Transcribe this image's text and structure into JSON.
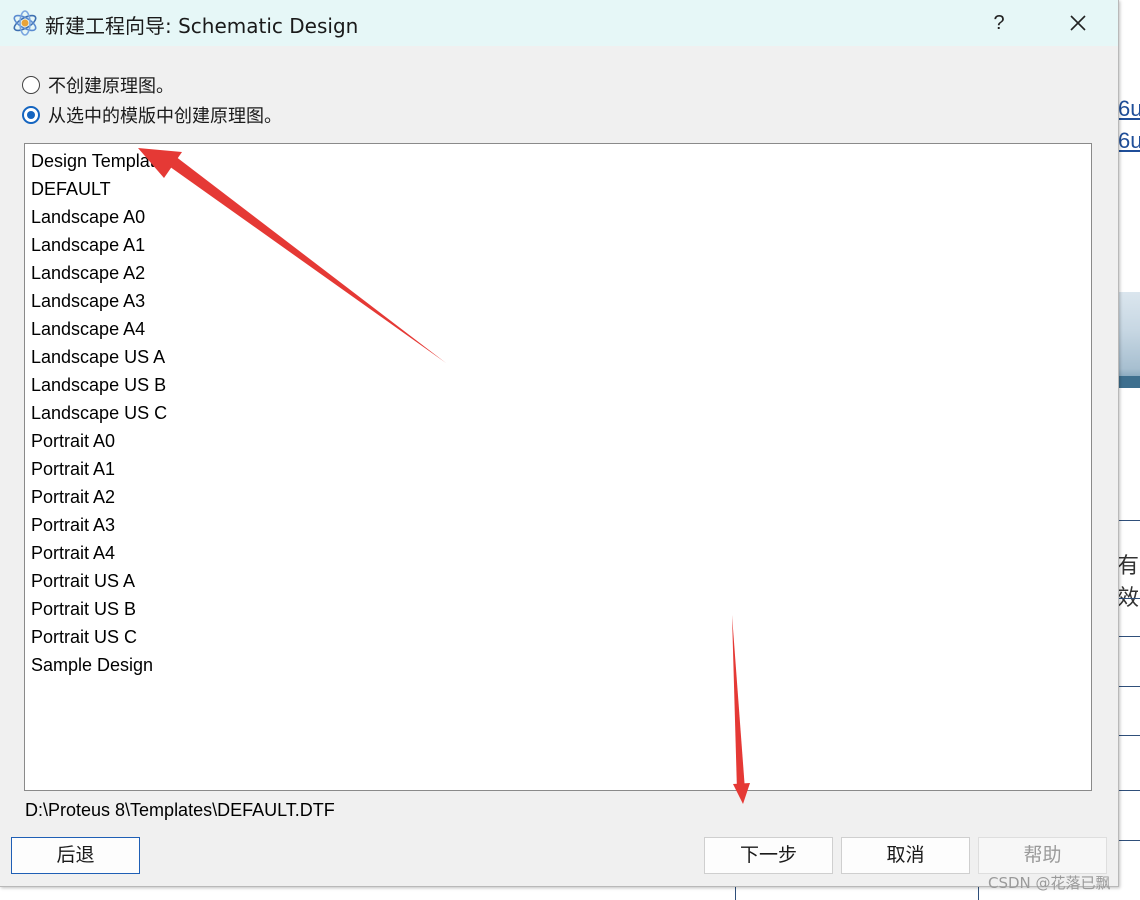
{
  "window": {
    "title": "新建工程向导: Schematic Design",
    "help_label": "?"
  },
  "options": [
    {
      "label": "不创建原理图。",
      "checked": false
    },
    {
      "label": "从选中的模版中创建原理图。",
      "checked": true
    }
  ],
  "templates": [
    "Design Templates",
    "DEFAULT",
    "Landscape A0",
    "Landscape A1",
    "Landscape A2",
    "Landscape A3",
    "Landscape A4",
    "Landscape US A",
    "Landscape US B",
    "Landscape US C",
    "Portrait A0",
    "Portrait A1",
    "Portrait A2",
    "Portrait A3",
    "Portrait A4",
    "Portrait US A",
    "Portrait US B",
    "Portrait US C",
    "Sample Design"
  ],
  "selected_path": "D:\\Proteus 8\\Templates\\DEFAULT.DTF",
  "buttons": {
    "back": "后退",
    "next": "下一步",
    "cancel": "取消",
    "help": "帮助"
  },
  "background": {
    "link1": "6u",
    "link2": "6u",
    "text": "有效"
  },
  "watermark": "CSDN @花落已飘",
  "colors": {
    "titlebar": "#e6f7f7",
    "dialog": "#f0f0f0",
    "accent": "#1565c0",
    "annotation_arrow": "#e53935"
  }
}
